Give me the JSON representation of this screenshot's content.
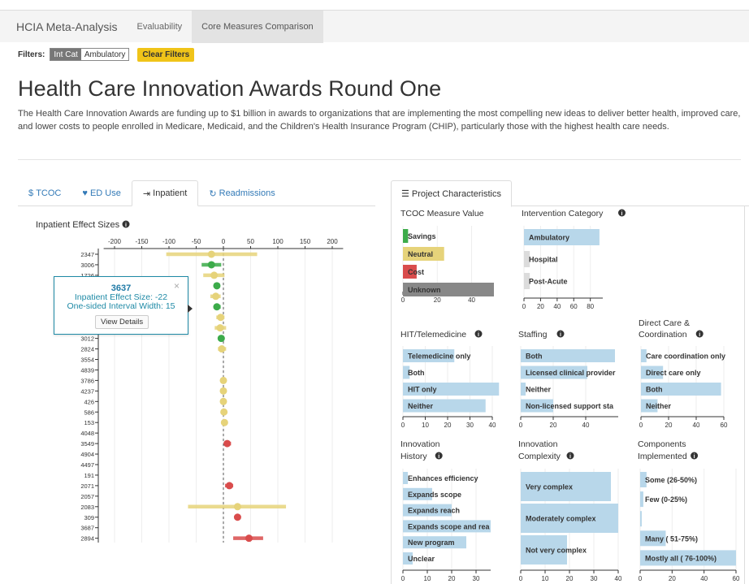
{
  "nav": {
    "brand": "HCIA Meta-Analysis",
    "items": [
      "Evaluability",
      "Core Measures Comparison"
    ]
  },
  "filters": {
    "label": "Filters:",
    "chip_key": "Int Cat",
    "chip_value": "Ambulatory",
    "clear": "Clear Filters"
  },
  "page": {
    "title": "Health Care Innovation Awards Round One",
    "description": "The Health Care Innovation Awards are funding up to $1 billion in awards to organizations that are implementing the most compelling new ideas to deliver better health, improved care, and lower costs to people enrolled in Medicare, Medicaid, and the Children's Health Insurance Program (CHIP), particularly those with the highest health care needs."
  },
  "left_tabs": [
    {
      "label": "TCOC",
      "icon": "dollar-icon"
    },
    {
      "label": "ED Use",
      "icon": "heart-icon"
    },
    {
      "label": "Inpatient",
      "icon": "sign-in-icon"
    },
    {
      "label": "Readmissions",
      "icon": "refresh-icon"
    }
  ],
  "right_tab": {
    "label": "Project Characteristics",
    "icon": "list-icon"
  },
  "colors": {
    "green": "#3cab4a",
    "yellow": "#e6d37a",
    "red": "#d94c4c",
    "blue": "#b8d7ea",
    "grey": "#888888"
  },
  "tooltip": {
    "id": "3637",
    "line1": "Inpatient Effect Size: -22",
    "line2": "One-sided Interval Width: 15",
    "button": "View Details"
  },
  "chart_data": [
    {
      "type": "scatter",
      "title": "Inpatient Effect Sizes",
      "xlim": [
        -220,
        220
      ],
      "xticks": [
        -200,
        -150,
        -100,
        -50,
        0,
        50,
        100,
        150,
        200
      ],
      "rows": [
        {
          "id": "2347",
          "effect": -22,
          "lo": -105,
          "hi": 62,
          "color": "yellow"
        },
        {
          "id": "3006",
          "effect": -22,
          "lo": -40,
          "hi": -4,
          "color": "green"
        },
        {
          "id": "1726",
          "effect": -17,
          "lo": -37,
          "hi": 2,
          "color": "yellow"
        },
        {
          "id": "",
          "effect": -12,
          "lo": -17,
          "hi": -6,
          "color": "green"
        },
        {
          "id": "",
          "effect": -14,
          "lo": -24,
          "hi": -5,
          "color": "yellow"
        },
        {
          "id": "3637",
          "effect": -12,
          "lo": -18,
          "hi": -5,
          "color": "green"
        },
        {
          "id": "",
          "effect": -5,
          "lo": -13,
          "hi": 2,
          "color": "yellow"
        },
        {
          "id": "",
          "effect": -6,
          "lo": -16,
          "hi": 5,
          "color": "yellow"
        },
        {
          "id": "3012",
          "effect": -4,
          "lo": -7,
          "hi": 0,
          "color": "green"
        },
        {
          "id": "2824",
          "effect": -3,
          "lo": -10,
          "hi": 5,
          "color": "yellow"
        },
        {
          "id": "3554",
          "effect": null,
          "lo": null,
          "hi": null,
          "color": "yellow"
        },
        {
          "id": "4839",
          "effect": null,
          "lo": null,
          "hi": null,
          "color": "yellow"
        },
        {
          "id": "3786",
          "effect": 0,
          "lo": -3,
          "hi": 3,
          "color": "yellow"
        },
        {
          "id": "4237",
          "effect": 0,
          "lo": -6,
          "hi": 5,
          "color": "yellow"
        },
        {
          "id": "426",
          "effect": 0,
          "lo": -4,
          "hi": 3,
          "color": "yellow"
        },
        {
          "id": "586",
          "effect": 1,
          "lo": -2,
          "hi": 4,
          "color": "yellow"
        },
        {
          "id": "153",
          "effect": 2,
          "lo": -3,
          "hi": 7,
          "color": "yellow"
        },
        {
          "id": "4048",
          "effect": null,
          "lo": null,
          "hi": null,
          "color": "yellow"
        },
        {
          "id": "3549",
          "effect": 7,
          "lo": 3,
          "hi": 14,
          "color": "red"
        },
        {
          "id": "4904",
          "effect": null,
          "lo": null,
          "hi": null,
          "color": "yellow"
        },
        {
          "id": "4497",
          "effect": null,
          "lo": null,
          "hi": null,
          "color": "yellow"
        },
        {
          "id": "191",
          "effect": null,
          "lo": null,
          "hi": null,
          "color": "yellow"
        },
        {
          "id": "2071",
          "effect": 11,
          "lo": 3,
          "hi": 18,
          "color": "red"
        },
        {
          "id": "2057",
          "effect": null,
          "lo": null,
          "hi": null,
          "color": "yellow"
        },
        {
          "id": "2083",
          "effect": 26,
          "lo": -65,
          "hi": 115,
          "color": "yellow"
        },
        {
          "id": "309",
          "effect": 26,
          "lo": 26,
          "hi": 26,
          "color": "red"
        },
        {
          "id": "3687",
          "effect": null,
          "lo": null,
          "hi": null,
          "color": "yellow"
        },
        {
          "id": "2894",
          "effect": 47,
          "lo": 18,
          "hi": 73,
          "color": "red"
        }
      ]
    },
    {
      "type": "bar",
      "title": "TCOC Measure Value",
      "xticks": [
        0,
        20,
        40
      ],
      "xmax": 53,
      "categories": [
        "Savings",
        "Neutral",
        "Cost",
        "Unknown"
      ],
      "values": [
        3,
        24,
        8,
        53
      ],
      "colors": [
        "green",
        "yellow",
        "red",
        "grey"
      ]
    },
    {
      "type": "bar",
      "title": "Intervention Category",
      "xticks": [
        0,
        20,
        40,
        60,
        80
      ],
      "xmax": 95,
      "categories": [
        "Ambulatory",
        "Hospital",
        "Post-Acute"
      ],
      "values": [
        91,
        7,
        7
      ],
      "colors": [
        "blue",
        "lightgrey",
        "lightgrey"
      ]
    },
    {
      "type": "bar",
      "title": "HIT/Telemedicine",
      "xticks": [
        0,
        10,
        20,
        30,
        40
      ],
      "xmax": 40,
      "categories": [
        "Telemedicine only",
        "Both",
        "HIT only",
        "Neither"
      ],
      "values": [
        23,
        3,
        43,
        37
      ],
      "colors": [
        "blue",
        "blue",
        "blue",
        "blue"
      ]
    },
    {
      "type": "bar",
      "title": "Staffing",
      "xticks": [
        0,
        20,
        40
      ],
      "xmax": 60,
      "categories": [
        "Both",
        "Licensed clinical provider",
        "Neither",
        "Non-licensed support sta"
      ],
      "values": [
        58,
        41,
        3,
        20
      ],
      "colors": [
        "blue",
        "blue",
        "blue",
        "blue"
      ]
    },
    {
      "type": "bar",
      "title": "Direct Care & Coordination",
      "xticks": [
        0,
        20,
        40,
        60
      ],
      "xmax": 60,
      "categories": [
        "Care coordination only",
        "Direct care only",
        "Both",
        "Neither"
      ],
      "values": [
        4,
        16,
        58,
        12
      ],
      "colors": [
        "blue",
        "blue",
        "blue",
        "blue"
      ]
    },
    {
      "type": "bar",
      "title": "Innovation History",
      "xticks": [
        0,
        10,
        20,
        30
      ],
      "xmax": 36,
      "categories": [
        "Enhances efficiency",
        "Expands scope",
        "Expands reach",
        "Expands scope and rea",
        "New program",
        "Unclear"
      ],
      "values": [
        2,
        12,
        20,
        36,
        26,
        4
      ],
      "colors": [
        "blue",
        "blue",
        "blue",
        "blue",
        "blue",
        "blue"
      ]
    },
    {
      "type": "bar",
      "title": "Innovation Complexity",
      "xticks": [
        0,
        10,
        20,
        30,
        40
      ],
      "xmax": 40,
      "categories": [
        "Very complex",
        "Moderately complex",
        "Not very complex"
      ],
      "values": [
        37,
        40,
        19
      ],
      "colors": [
        "blue",
        "blue",
        "blue"
      ]
    },
    {
      "type": "bar",
      "title": "Components Implemented",
      "xticks": [
        0,
        20,
        40,
        60
      ],
      "xmax": 60,
      "categories": [
        "Some (26-50%)",
        "Few (0-25%)",
        "",
        "Many ( 51-75%)",
        "Mostly all ( 76-100%)"
      ],
      "values": [
        4,
        2,
        1,
        16,
        60
      ],
      "colors": [
        "blue",
        "blue",
        "blue",
        "blue",
        "blue"
      ]
    }
  ]
}
